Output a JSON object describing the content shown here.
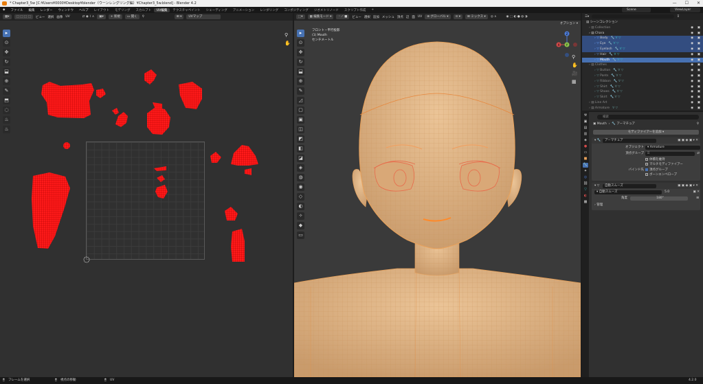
{
  "window": {
    "title": "* Chapter3_5w [C:¥Users¥0000¥Desktop¥blender（ウーンレングリング編）¥Chapter3_5w.blend] - Blender 4.2"
  },
  "menubar": {
    "items": [
      "ファイル",
      "編集",
      "レンダー",
      "ウィンドウ",
      "ヘルプ"
    ],
    "workspaces": [
      "レイアウト",
      "モデリング",
      "スカルプト",
      "UV編集",
      "テクスチャペイント",
      "シェーディング",
      "アニメーション",
      "レンダリング",
      "コンポジティング",
      "ジオメトリノード",
      "スクリプト作成"
    ],
    "active_workspace": "UV編集",
    "add": "+",
    "scene": "Scene",
    "view_layer": "ViewLayer"
  },
  "uv_editor": {
    "header": [
      "ビュー",
      "選択",
      "画像",
      "UV"
    ],
    "new_label": "新規",
    "open_label": "開く",
    "uvmap": "UVマップ"
  },
  "viewport": {
    "mode": "編集モード",
    "menus": [
      "ビュー",
      "選択",
      "追加",
      "メッシュ",
      "頂点",
      "辺",
      "面",
      "UV"
    ],
    "orientation": "グローバル",
    "pivot": "ミックス",
    "options": "オプション",
    "info": [
      "フロント・平行投影",
      "(1) Mouth",
      "センチメートル"
    ],
    "gizmo": {
      "x": "X",
      "y": "Y",
      "z": "Z"
    },
    "colors": {
      "skin": "#e3b886",
      "wire": "#e8a15a",
      "edge_sel": "#e8863a"
    }
  },
  "outliner": {
    "header_label": "シーンコレクション",
    "rows": [
      {
        "name": "Collection",
        "dim": true,
        "indent": 1
      },
      {
        "name": "Chara",
        "dim": false,
        "indent": 1
      },
      {
        "name": "Body",
        "dim": false,
        "indent": 2,
        "sel": "sel",
        "mods": "🔧 ∀ ▽"
      },
      {
        "name": "Eye",
        "dim": false,
        "indent": 2,
        "sel": "sel",
        "mods": "🔧 ∀ ▽"
      },
      {
        "name": "Eyelash",
        "dim": false,
        "indent": 2,
        "sel": "sel",
        "mods": "🔧 ∀ ▽"
      },
      {
        "name": "Hair",
        "dim": false,
        "indent": 2,
        "mods": "🔧 ∀ ▽"
      },
      {
        "name": "Mouth",
        "dim": false,
        "indent": 2,
        "sel": "selb",
        "mods": "🔧 ∀ ▽"
      },
      {
        "name": "Clothes",
        "dim": true,
        "indent": 1
      },
      {
        "name": "Button",
        "dim": true,
        "indent": 2,
        "mods": "🔧 ∀ ▽"
      },
      {
        "name": "Pants",
        "dim": true,
        "indent": 2,
        "mods": "🔧 ∀ ▽"
      },
      {
        "name": "Ribbon",
        "dim": true,
        "indent": 2,
        "mods": "🔧 ∀ ▽"
      },
      {
        "name": "Shirt",
        "dim": true,
        "indent": 2,
        "mods": "🔧 ∀ ▽"
      },
      {
        "name": "Shoes",
        "dim": true,
        "indent": 2,
        "mods": "🔧 ∀ ▽"
      },
      {
        "name": "Skirt",
        "dim": true,
        "indent": 2,
        "mods": "🔧 ∀ ▽"
      },
      {
        "name": "Line Art",
        "dim": true,
        "indent": 1
      },
      {
        "name": "Armature",
        "dim": true,
        "indent": 1,
        "mods": "∀ ▽"
      }
    ]
  },
  "properties": {
    "search_placeholder": "検索",
    "object": "Mouth",
    "modifier_ctx": "アーマチュア",
    "add_modifier": "モディファイアーを追加",
    "arm": {
      "name": "アーマチュア",
      "object_label": "オブジェクト",
      "object_value": "Armature",
      "vgroup_label": "頂点グループ",
      "preserve_volume": "体積を維持",
      "multi_mod": "マルチモディファイアー",
      "bind_label": "バインド先",
      "vgroups": "頂点グループ",
      "envelopes": "ボーンエンベロープ"
    },
    "smooth": {
      "name": "自動スムーズ",
      "sub_name": "自動スムーズ",
      "angle_label": "角度",
      "angle_value": "180°",
      "sub_val": "5.0",
      "manage": "管理"
    }
  },
  "status": {
    "left": "フレームを選択",
    "mid": "視点の移動",
    "right": "UV",
    "version": "4.2.0"
  }
}
